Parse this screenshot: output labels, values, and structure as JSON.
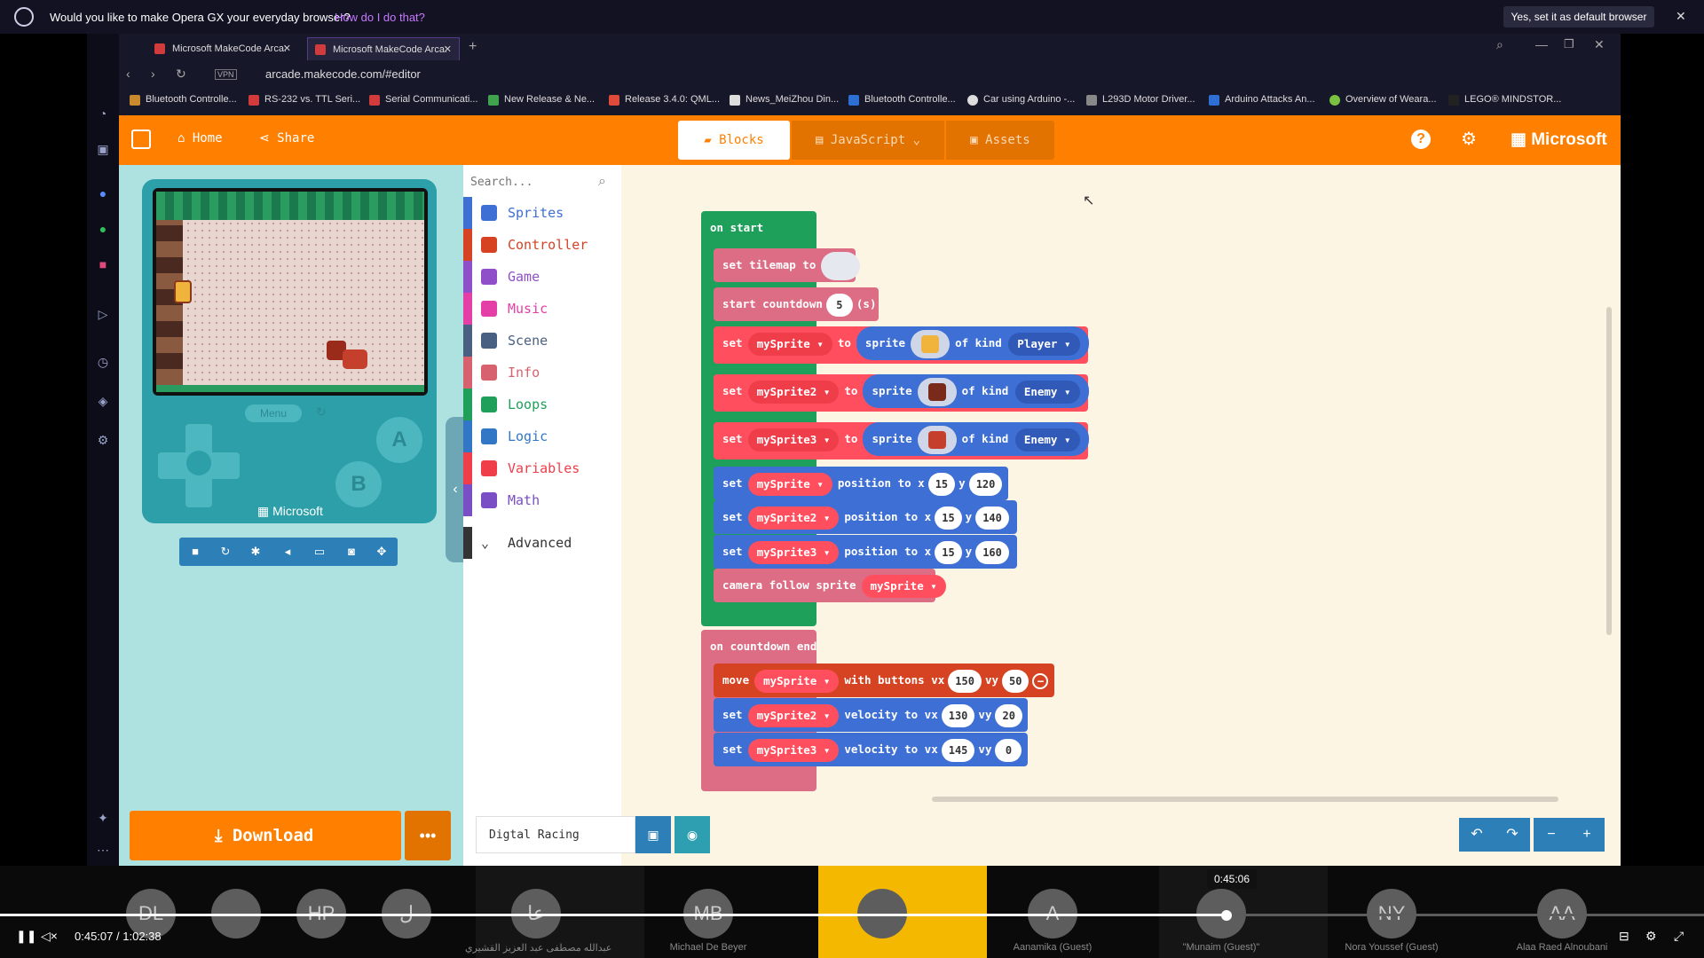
{
  "banner": {
    "question": "Would you like to make Opera GX your everyday browser?",
    "how": "How do I do that?",
    "yes": "Yes, set it as default browser"
  },
  "browser": {
    "tabs": [
      "Microsoft MakeCode Arca:",
      "Microsoft MakeCode Arca:"
    ],
    "url": "arcade.makecode.com/#editor",
    "vpn": "VPN",
    "bookmarks": [
      "Bluetooth Controlle...",
      "RS-232 vs. TTL Seri...",
      "Serial Communicati...",
      "New Release & Ne...",
      "Release 3.4.0: QML...",
      "News_MeiZhou Din...",
      "Bluetooth Controlle...",
      "Car using Arduino -...",
      "L293D Motor Driver...",
      "Arduino Attacks An...",
      "Overview of Weara...",
      "LEGO® MINDSTOR..."
    ]
  },
  "header": {
    "home": "Home",
    "share": "Share",
    "tab_blocks": "Blocks",
    "tab_js": "JavaScript",
    "tab_assets": "Assets",
    "brand": "Microsoft"
  },
  "simulator": {
    "menu": "Menu",
    "a": "A",
    "b": "B",
    "brand": "Microsoft"
  },
  "toolbox": {
    "search_placeholder": "Search...",
    "categories": [
      {
        "label": "Sprites",
        "color": "#3e6fd4"
      },
      {
        "label": "Controller",
        "color": "#d54322"
      },
      {
        "label": "Game",
        "color": "#8f4fc9"
      },
      {
        "label": "Music",
        "color": "#e43ea7"
      },
      {
        "label": "Scene",
        "color": "#4a6082"
      },
      {
        "label": "Info",
        "color": "#d8616f"
      },
      {
        "label": "Loops",
        "color": "#1fa05a"
      },
      {
        "label": "Logic",
        "color": "#3177c6"
      },
      {
        "label": "Variables",
        "color": "#ef3d4a"
      },
      {
        "label": "Math",
        "color": "#7a4ec4"
      }
    ],
    "advanced": "Advanced"
  },
  "blocks": {
    "on_start": "on start",
    "set_tilemap": "set tilemap to",
    "start_countdown": "start countdown",
    "countdown_val": "5",
    "countdown_unit": "(s)",
    "set": "set",
    "to": "to",
    "sprite": "sprite",
    "of_kind": "of kind",
    "kind_player": "Player",
    "kind_enemy": "Enemy",
    "v1": "mySprite",
    "v2": "mySprite2",
    "v3": "mySprite3",
    "position_to_x": "position to x",
    "y": "y",
    "p1x": "15",
    "p1y": "120",
    "p2x": "15",
    "p2y": "140",
    "p3x": "15",
    "p3y": "160",
    "camera_follow": "camera follow sprite",
    "on_countdown_end": "on countdown end",
    "move": "move",
    "with_buttons_vx": "with buttons vx",
    "vy": "vy",
    "m_vx": "150",
    "m_vy": "50",
    "velocity_to_vx": "velocity to vx",
    "v2_vx": "130",
    "v2_vy": "20",
    "v3_vx": "145",
    "v3_vy": "0"
  },
  "footer": {
    "download": "Download",
    "more": "•••",
    "project_name": "Digtal Racing"
  },
  "video": {
    "participants": [
      {
        "initials": "DL",
        "name": ""
      },
      {
        "initials": "",
        "name": ""
      },
      {
        "initials": "HP",
        "name": ""
      },
      {
        "initials": "ل",
        "name": ""
      },
      {
        "initials": "عا",
        "name": "عبدالله مصطفى عبد العزيز القشيري"
      },
      {
        "initials": "MB",
        "name": "Michael De Beyer"
      },
      {
        "initials": "",
        "name": ""
      },
      {
        "initials": "A",
        "name": "Aanamika (Guest)"
      },
      {
        "initials": "",
        "name": "\"Munaim (Guest)\""
      },
      {
        "initials": "NY",
        "name": "Nora Youssef (Guest)"
      },
      {
        "initials": "AA",
        "name": "Alaa Raed Alnoubani"
      }
    ],
    "current_time": "0:45:07",
    "separator": "/",
    "duration": "1:02:38",
    "tooltip": "0:45:06",
    "progress": 0.72
  }
}
